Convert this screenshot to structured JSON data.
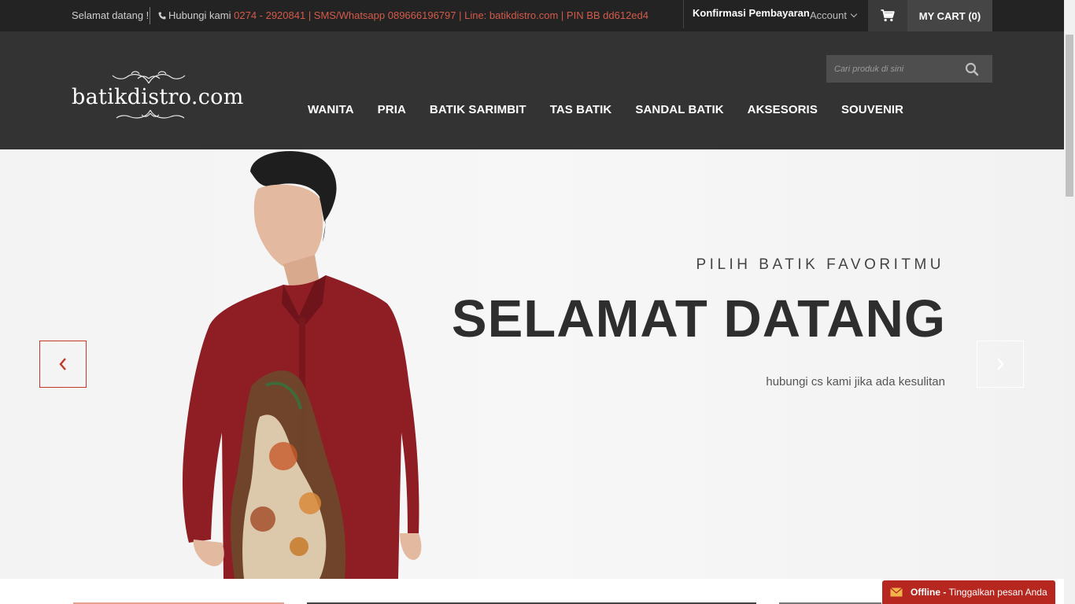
{
  "topbar": {
    "welcome": "Selamat datang !",
    "contact_prefix": "Hubungi kami",
    "contact_details": "0274 - 2920841 | SMS/Whatsapp 089666196797 | Line: batikdistro.com | PIN BB dd612ed4",
    "confirm_payment": "Konfirmasi Pembayaran",
    "account": "Account",
    "cart": "MY CART (0)"
  },
  "header": {
    "logo_text": "batikdistro.com",
    "search_placeholder": "Cari produk di sini"
  },
  "nav": {
    "items": [
      "WANITA",
      "PRIA",
      "BATIK SARIMBIT",
      "TAS BATIK",
      "SANDAL BATIK",
      "AKSESORIS",
      "SOUVENIR"
    ]
  },
  "hero": {
    "subtitle": "PILIH BATIK FAVORITMU",
    "title": "SELAMAT DATANG",
    "description": "hubungi cs kami jika ada kesulitan"
  },
  "chat": {
    "status": "Offline -",
    "message": "Tinggalkan pesan Anda"
  },
  "colors": {
    "topbar_bg": "#232323",
    "header_bg": "#333333",
    "accent_red": "#c0392b",
    "contact_highlight": "#d45a4a",
    "chat_bg": "#b5271f"
  },
  "icons": {
    "phone": "phone-icon",
    "cart": "shopping-cart-icon",
    "search": "search-icon",
    "prev": "chevron-left-icon",
    "next": "chevron-right-icon",
    "chat": "envelope-icon"
  }
}
